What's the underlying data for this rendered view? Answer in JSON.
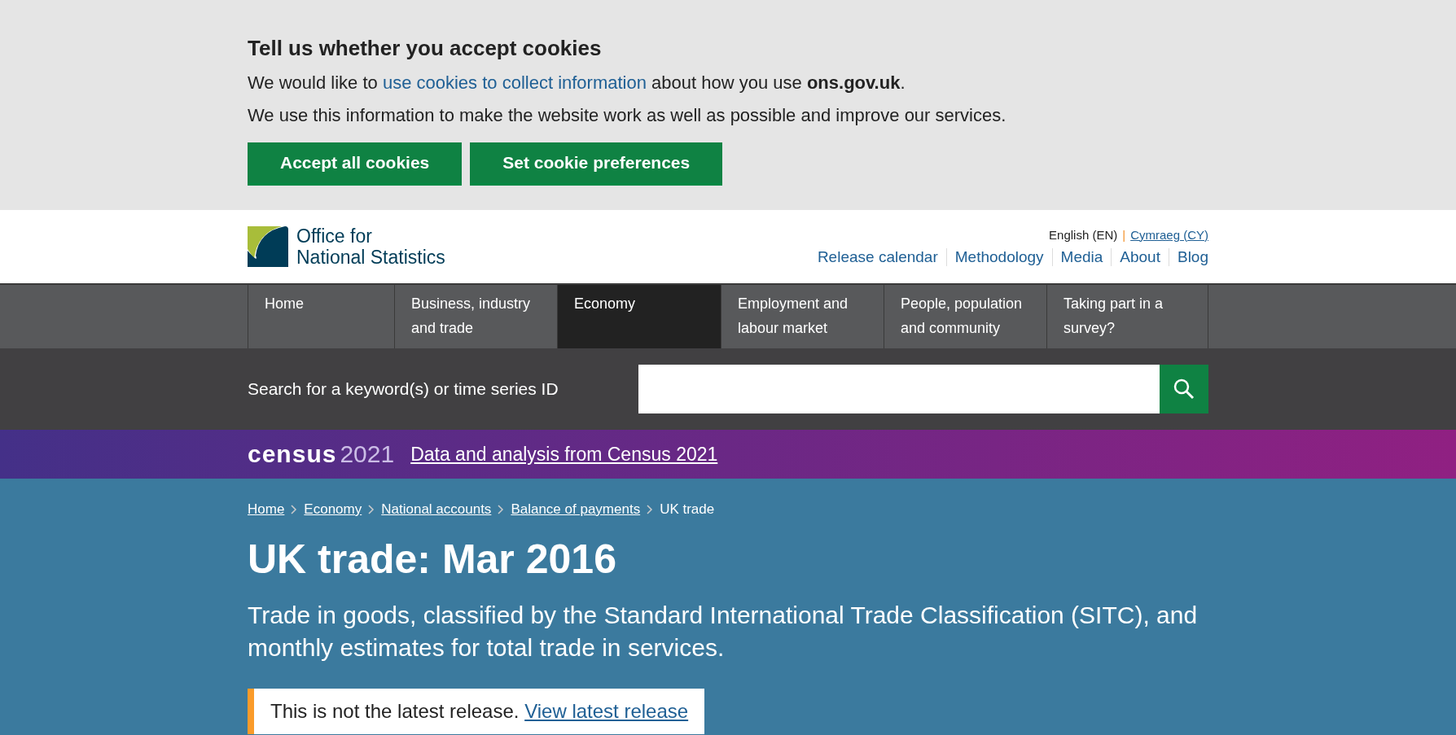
{
  "cookie_banner": {
    "title": "Tell us whether you accept cookies",
    "line_1_before": "We would like to",
    "line_1_link": "use cookies to collect information",
    "line_1_after": "about how you use **ons.gov.uk**.",
    "line_2": "We use this information to make the website work as well as possible and improve our services.",
    "buttons": [
      "Accept all cookies",
      "Set cookie preferences"
    ]
  },
  "header": {
    "logo_line_1": "Office for",
    "logo_line_2": "National Statistics",
    "language_current": "English (EN)",
    "language_separator": "|",
    "language_other": "Cymraeg (CY)",
    "links": [
      "Release calendar",
      "Methodology",
      "Media",
      "About",
      "Blog"
    ]
  },
  "nav": [
    {
      "label": "Home",
      "selected": false
    },
    {
      "label": "Business, industry and trade",
      "selected": false
    },
    {
      "label": "Economy",
      "selected": true
    },
    {
      "label": "Employment and labour market",
      "selected": false
    },
    {
      "label": "People, population and community",
      "selected": false
    },
    {
      "label": "Taking part in a survey?",
      "selected": false
    }
  ],
  "search": {
    "label": "Search for a keyword(s) or time series ID"
  },
  "census": {
    "logo_word": "census",
    "logo_year": "2021",
    "link": "Data and analysis from Census 2021"
  },
  "breadcrumbs": [
    {
      "label": "Home",
      "kind": "link"
    },
    {
      "label": "Economy",
      "kind": "link"
    },
    {
      "label": "National accounts",
      "kind": "link"
    },
    {
      "label": "Balance of payments",
      "kind": "link"
    },
    {
      "label": "UK trade",
      "kind": "current"
    }
  ],
  "page": {
    "title": "UK trade: Mar 2016",
    "summary": "Trade in goods, classified by the Standard International Trade Classification (SITC), and monthly estimates for total trade in services."
  },
  "notice": {
    "text": "This is not the latest release.",
    "link": "View latest release"
  }
}
